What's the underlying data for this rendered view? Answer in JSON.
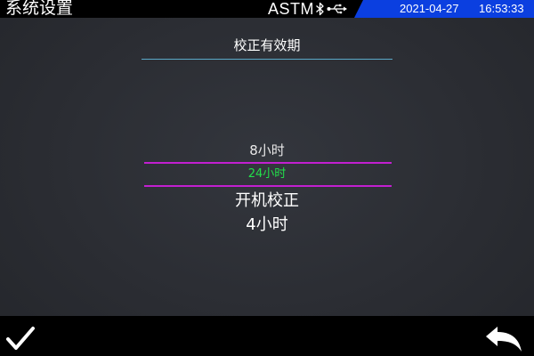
{
  "statusbar": {
    "title": "系统设置",
    "mode": "ASTM",
    "date": "2021-04-27",
    "time": "16:53:33",
    "icons": [
      "bluetooth-icon",
      "usb-icon"
    ]
  },
  "page": {
    "title": "校正有效期"
  },
  "picker": {
    "prev_option": "8小时",
    "selected_option": "24小时",
    "next_options": [
      "开机校正",
      "4小时"
    ]
  },
  "toolbar": {
    "icons": [
      "checkmark-icon",
      "back-arrow-icon"
    ]
  },
  "colors": {
    "accent_blue": "#0b3fe0",
    "selected_text": "#22e04a",
    "selection_lines": "#c21fd0",
    "title_underline": "#5aa9c8"
  }
}
